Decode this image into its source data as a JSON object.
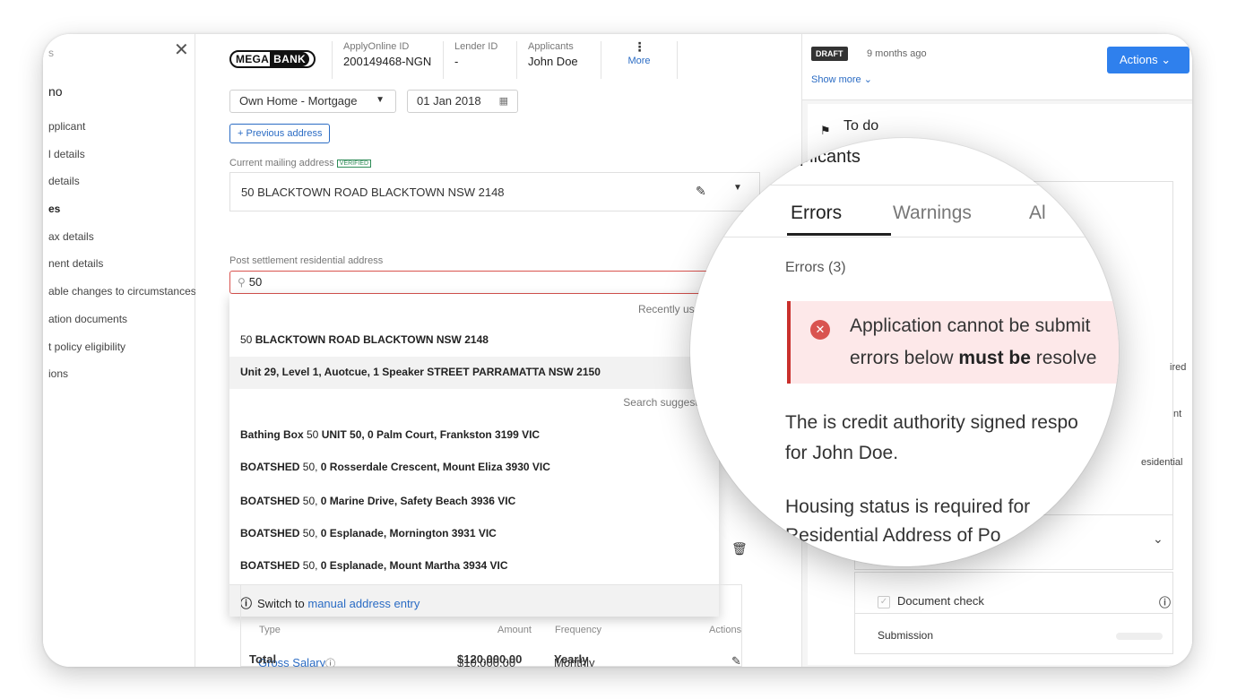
{
  "sidebar": {
    "title": "s",
    "subtitle": "no",
    "items": [
      {
        "label": "pplicant",
        "bold": false
      },
      {
        "label": "l details",
        "bold": false
      },
      {
        "label": "details",
        "bold": false
      },
      {
        "label": "es",
        "bold": true
      },
      {
        "label": "ax details",
        "bold": false
      },
      {
        "label": "nent details",
        "bold": false
      },
      {
        "label": "able changes to circumstances",
        "bold": false
      },
      {
        "label": "ation documents",
        "bold": false
      },
      {
        "label": "t policy eligibility",
        "bold": false
      },
      {
        "label": "ions",
        "bold": false
      }
    ]
  },
  "header": {
    "logo_part1": "MEGA",
    "logo_part2": "BANK",
    "applyonline_label": "ApplyOnline ID",
    "applyonline_value": "200149468-NGN",
    "lender_label": "Lender ID",
    "lender_value": "-",
    "applicants_label": "Applicants",
    "applicants_value": "John Doe",
    "more_dots": "⋮",
    "more_label": "More"
  },
  "form": {
    "housing_select": "Own Home - Mortgage",
    "date_value": "01 Jan 2018",
    "previous_address_button": "+ Previous address",
    "current_mailing_label": "Current mailing address",
    "verified_badge": "VERIFIED",
    "current_mailing_value": "50 BLACKTOWN ROAD BLACKTOWN NSW 2148",
    "post_settlement_label": "Post settlement residential address",
    "search_value": "50"
  },
  "dropdown": {
    "recently_used_heading": "Recently used",
    "recent": [
      {
        "prefix": "50 ",
        "bold": "BLACKTOWN ROAD BLACKTOWN NSW 2148"
      },
      {
        "prefix": "",
        "bold": "Unit 29, Level 1, Auotcue, 1 Speaker STREET PARRAMATTA NSW 2150"
      }
    ],
    "suggestions_heading": "Search suggestio",
    "suggestions": [
      {
        "bold1": "Bathing Box ",
        "plain": "50 ",
        "bold2": "UNIT 50, 0 Palm Court, Frankston 3199 VIC"
      },
      {
        "bold1": "BOATSHED ",
        "plain": "50, ",
        "bold2": "0 Rosserdale Crescent, Mount Eliza 3930 VIC"
      },
      {
        "bold1": "BOATSHED ",
        "plain": "50, ",
        "bold2": "0 Marine Drive, Safety Beach 3936 VIC"
      },
      {
        "bold1": "BOATSHED ",
        "plain": "50, ",
        "bold2": "0 Esplanade, Mornington 3931 VIC"
      },
      {
        "bold1": "BOATSHED ",
        "plain": "50, ",
        "bold2": "0 Esplanade, Mount Martha 3934 VIC"
      }
    ],
    "footer_prefix": "Switch to ",
    "footer_link": "manual address entry"
  },
  "income": {
    "col_type": "Type",
    "col_amount": "Amount",
    "col_frequency": "Frequency",
    "col_actions": "Actions",
    "row1_type": "Gross Salary",
    "row1_amount": "$10,000.00",
    "row1_frequency": "Monthly",
    "total_label": "Total",
    "total_amount": "$120,000.00",
    "total_frequency": "Yearly"
  },
  "right_panel": {
    "draft_badge": "DRAFT",
    "draft_time": "9 months ago",
    "show_more": "Show more ⌄",
    "actions_button": "Actions  ⌄",
    "todo_label": "To do",
    "peek_ired": "ired",
    "peek_nt": "nt",
    "peek_residential": "esidential",
    "document_check": "Document check",
    "submission": "Submission"
  },
  "magnifier": {
    "plicants": "plicants",
    "tab_errors": "Errors",
    "tab_warnings": "Warnings",
    "tab_all": "Al",
    "errors_count": "Errors (3)",
    "alert_line1": "Application cannot be submit",
    "alert_line2_pre": "errors below ",
    "alert_line2_bold": "must be",
    "alert_line2_post": " resolve",
    "error1_line1": "The is credit authority signed respo",
    "error1_line2": "for John Doe.",
    "error2_line1": "Housing status is required for",
    "error2_line2": "Residential Address of Po"
  }
}
